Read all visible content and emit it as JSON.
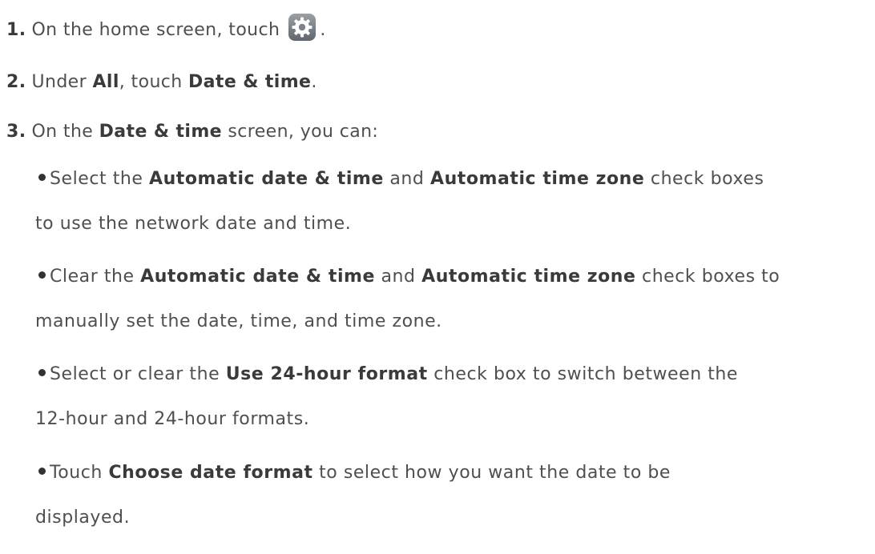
{
  "steps": [
    {
      "number": "1.",
      "before": "On the home screen, touch",
      "after": "."
    },
    {
      "number": "2.",
      "text1": "Under ",
      "bold1": "All",
      "text2": ", touch ",
      "bold2": "Date & time",
      "text3": "."
    },
    {
      "number": "3.",
      "text1": "On the ",
      "bold1": "Date & time",
      "text2": " screen, you can:"
    }
  ],
  "icon": "settings-gear-icon",
  "bullets": [
    {
      "line1": {
        "t1": "Select the ",
        "b1": "Automatic date & time",
        "t2": " and ",
        "b2": "Automatic time zone",
        "t3": " check boxes"
      },
      "line2": "to use the network date and time."
    },
    {
      "line1": {
        "t1": "Clear the ",
        "b1": "Automatic date & time",
        "t2": " and ",
        "b2": "Automatic time zone",
        "t3": " check boxes to"
      },
      "line2": "manually set the date, time, and time zone."
    },
    {
      "line1": {
        "t1": "Select or clear the ",
        "b1": "Use 24-hour format",
        "t2": " check box to switch between the"
      },
      "line2": "12-hour and 24-hour formats."
    },
    {
      "line1": {
        "t1": "Touch ",
        "b1": "Choose date format",
        "t2": " to select how you want the date to be"
      },
      "line2": "displayed."
    }
  ]
}
